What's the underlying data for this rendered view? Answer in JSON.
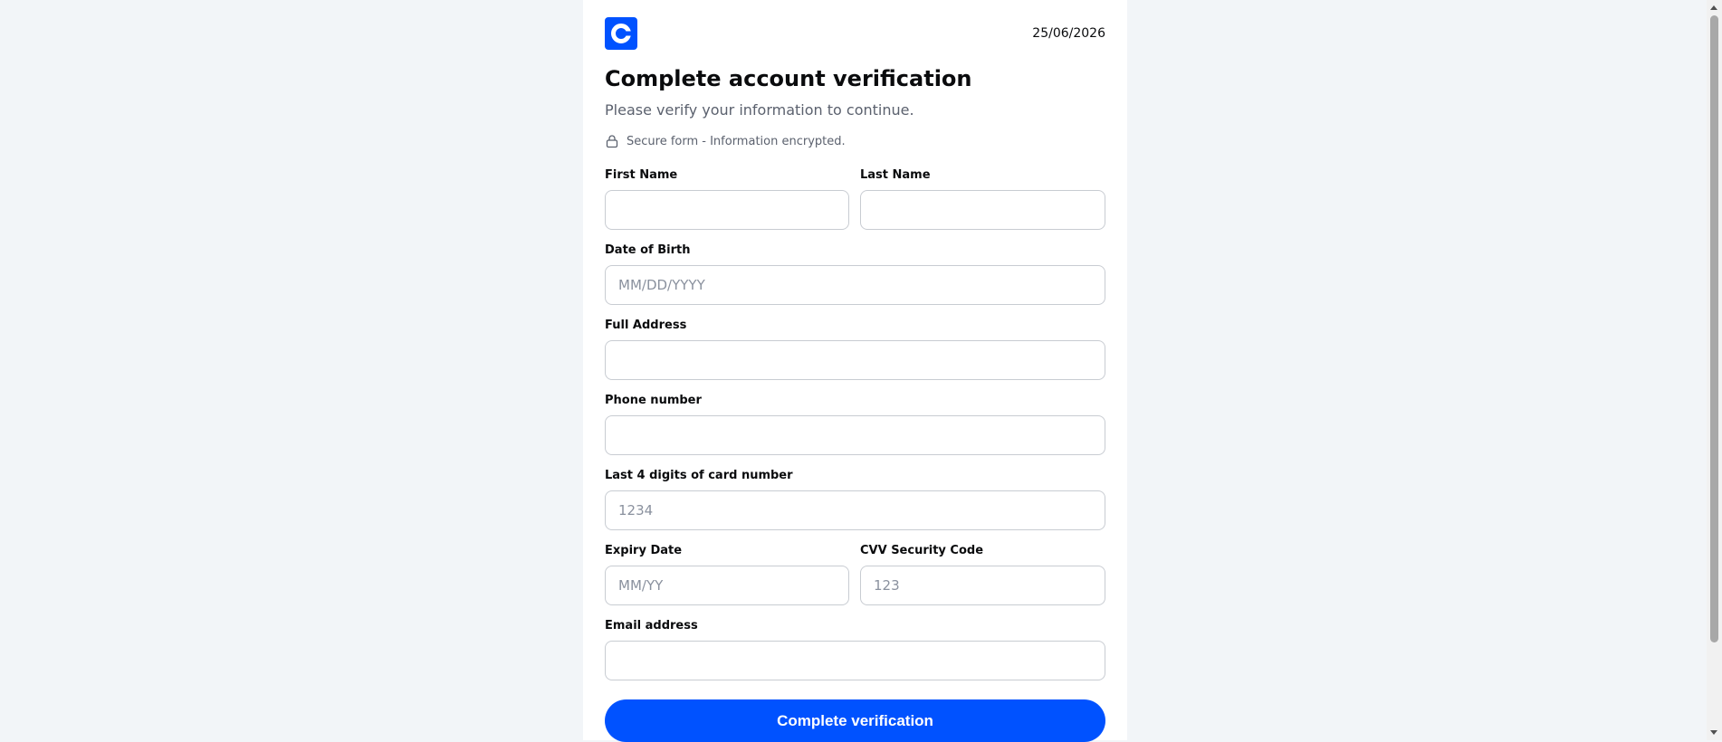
{
  "header": {
    "logo_icon": "coinbase-c-logo-icon",
    "date": "25/06/2026"
  },
  "page": {
    "title": "Complete account verification",
    "subtitle": "Please verify your information to continue.",
    "secure_note": "Secure form - Information encrypted.",
    "secure_icon": "lock-icon"
  },
  "form": {
    "first_name": {
      "label": "First Name",
      "value": "",
      "placeholder": ""
    },
    "last_name": {
      "label": "Last Name",
      "value": "",
      "placeholder": ""
    },
    "dob": {
      "label": "Date of Birth",
      "value": "",
      "placeholder": "MM/DD/YYYY"
    },
    "address": {
      "label": "Full Address",
      "value": "",
      "placeholder": ""
    },
    "phone": {
      "label": "Phone number",
      "value": "",
      "placeholder": ""
    },
    "card_last4": {
      "label": "Last 4 digits of card number",
      "value": "",
      "placeholder": "1234"
    },
    "expiry": {
      "label": "Expiry Date",
      "value": "",
      "placeholder": "MM/YY"
    },
    "cvv": {
      "label": "CVV Security Code",
      "value": "",
      "placeholder": "123"
    },
    "email": {
      "label": "Email address",
      "value": "",
      "placeholder": ""
    },
    "submit_label": "Complete verification"
  },
  "colors": {
    "brand": "#0052ff",
    "background": "#f2f5f8",
    "text": "#0a0b0d",
    "muted": "#5b616e",
    "border": "#c8ccd2"
  }
}
